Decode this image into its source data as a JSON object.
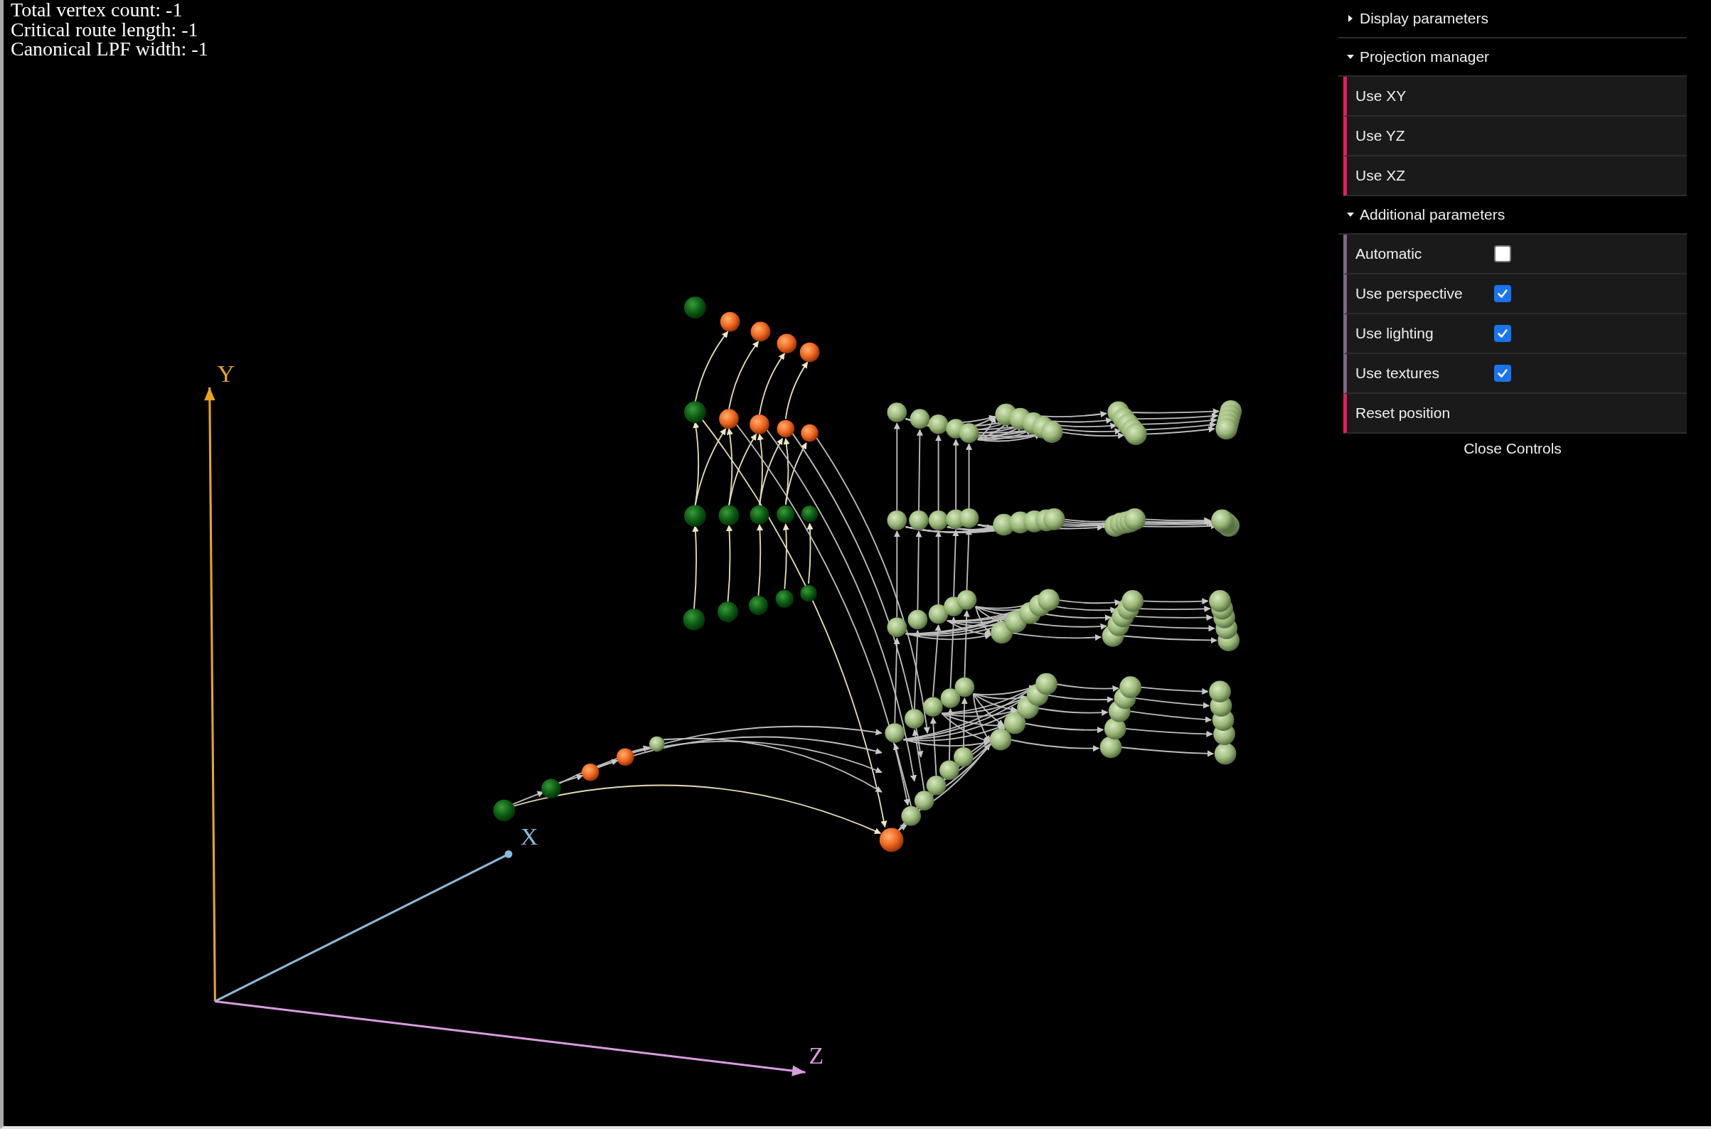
{
  "stats": [
    "Total vertex count: -1",
    "Critical route length: -1",
    "Canonical LPF width: -1"
  ],
  "scene": {
    "axes": [
      {
        "label": "Y"
      },
      {
        "label": "X"
      },
      {
        "label": "Z"
      }
    ]
  },
  "controls": {
    "folders": [
      {
        "title": "Display parameters",
        "expanded": false
      },
      {
        "title": "Projection manager",
        "expanded": true,
        "items": [
          {
            "kind": "button",
            "label": "Use XY"
          },
          {
            "kind": "button",
            "label": "Use YZ"
          },
          {
            "kind": "button",
            "label": "Use XZ"
          }
        ]
      },
      {
        "title": "Additional parameters",
        "expanded": true,
        "items": [
          {
            "kind": "checkbox",
            "label": "Automatic",
            "checked": false
          },
          {
            "kind": "checkbox",
            "label": "Use perspective",
            "checked": true
          },
          {
            "kind": "checkbox",
            "label": "Use lighting",
            "checked": true
          },
          {
            "kind": "checkbox",
            "label": "Use textures",
            "checked": true
          },
          {
            "kind": "button",
            "label": "Reset position"
          }
        ]
      }
    ],
    "close_label": "Close Controls"
  }
}
